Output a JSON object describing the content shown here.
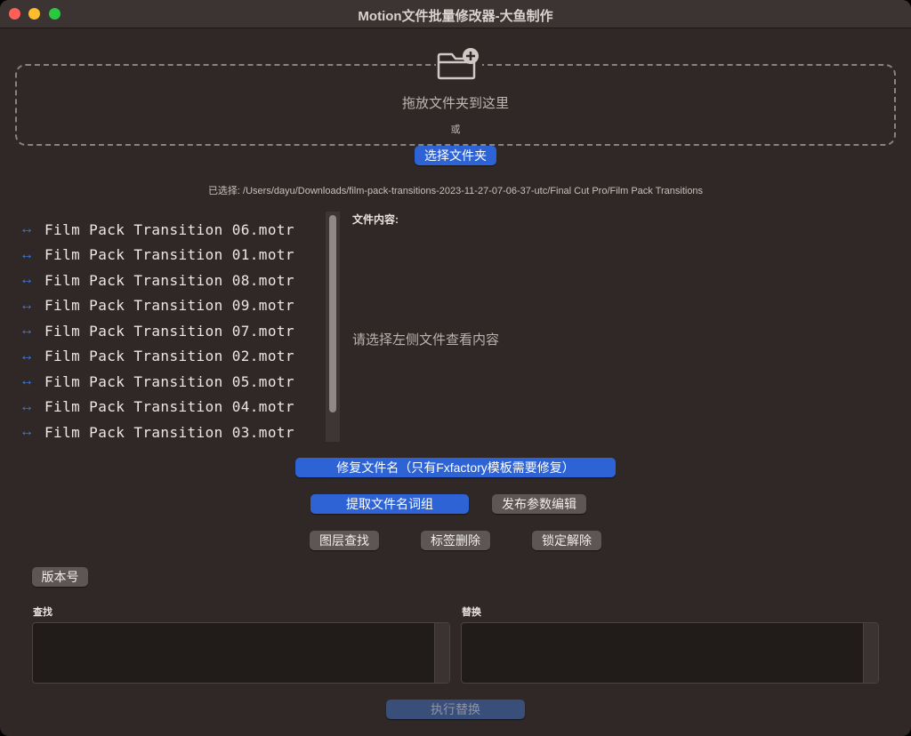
{
  "window": {
    "title": "Motion文件批量修改器-大鱼制作"
  },
  "dropzone": {
    "icon": "folder-plus-icon",
    "text": "拖放文件夹到这里",
    "or": "或",
    "select_button": "选择文件夹"
  },
  "selected_path": "已选择: /Users/dayu/Downloads/film-pack-transitions-2023-11-27-07-06-37-utc/Final Cut Pro/Film Pack Transitions",
  "file_list": {
    "item_icon": "↔",
    "items": [
      "Film Pack Transition 06.motr",
      "Film Pack Transition 01.motr",
      "Film Pack Transition 08.motr",
      "Film Pack Transition 09.motr",
      "Film Pack Transition 07.motr",
      "Film Pack Transition 02.motr",
      "Film Pack Transition 05.motr",
      "Film Pack Transition 04.motr",
      "Film Pack Transition 03.motr"
    ]
  },
  "content_panel": {
    "label": "文件内容:",
    "placeholder": "请选择左侧文件查看内容"
  },
  "actions": {
    "fix_names": "修复文件名（只有Fxfactory模板需要修复）",
    "extract_words": "提取文件名词组",
    "publish_params": "发布参数编辑",
    "layer_find": "图层查找",
    "tag_delete": "标签删除",
    "unlock": "锁定解除",
    "version": "版本号"
  },
  "find": {
    "label": "查找",
    "value": ""
  },
  "replace": {
    "label": "替换",
    "value": ""
  },
  "execute_button": "执行替换",
  "colors": {
    "accent": "#2e63d6",
    "background": "#2f2826",
    "list_icon": "#3d7de8"
  }
}
